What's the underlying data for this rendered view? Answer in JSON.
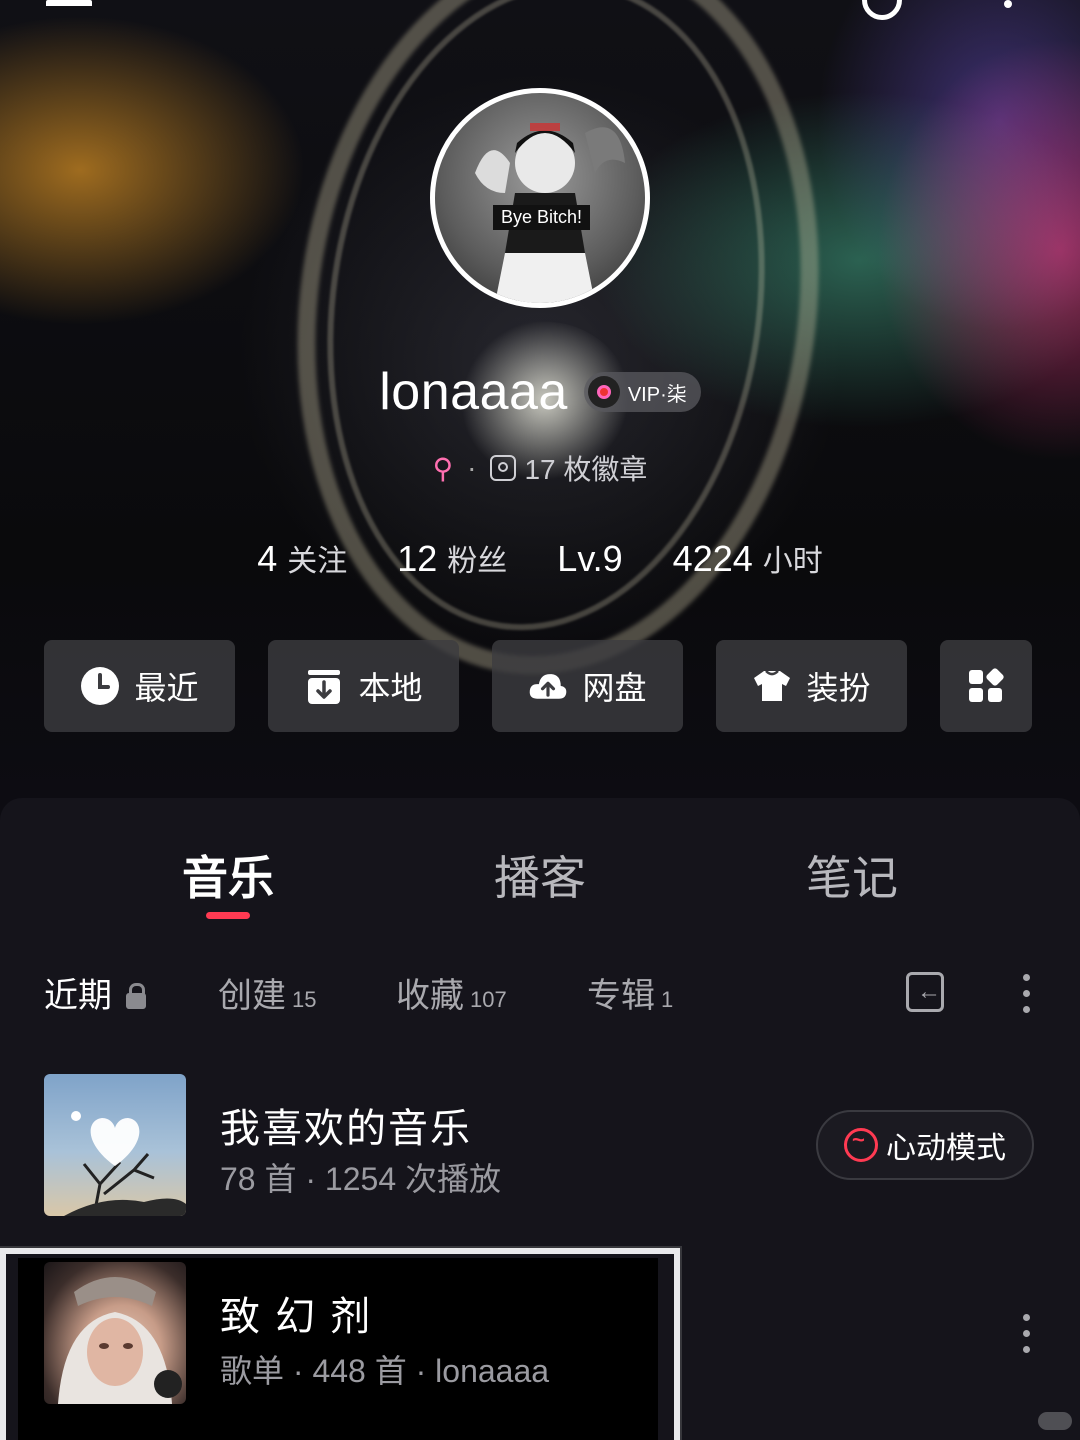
{
  "profile": {
    "avatar_caption": "Bye Bitch!",
    "username": "lonaaaa",
    "vip_label": "VIP·柒",
    "gender_symbol": "⚲",
    "separator": "·",
    "badges_text": "17 枚徽章"
  },
  "stats": [
    {
      "value": "4",
      "label": "关注"
    },
    {
      "value": "12",
      "label": "粉丝"
    },
    {
      "value": "Lv.9",
      "label": ""
    },
    {
      "value": "4224",
      "label": "小时"
    }
  ],
  "quick_actions": [
    {
      "label": "最近",
      "icon": "clock-icon"
    },
    {
      "label": "本地",
      "icon": "download-box-icon"
    },
    {
      "label": "网盘",
      "icon": "cloud-upload-icon"
    },
    {
      "label": "装扮",
      "icon": "tshirt-icon"
    },
    {
      "label": "",
      "icon": "apps-grid-icon"
    }
  ],
  "tabs": [
    "音乐",
    "播客",
    "笔记"
  ],
  "subtabs": [
    {
      "label": "近期",
      "count": ""
    },
    {
      "label": "创建",
      "count": "15"
    },
    {
      "label": "收藏",
      "count": "107"
    },
    {
      "label": "专辑",
      "count": "1"
    }
  ],
  "playlists": [
    {
      "title": "我喜欢的音乐",
      "meta": "78 首 · 1254 次播放",
      "action": "心动模式"
    },
    {
      "title": "致 幻 剂",
      "meta": "歌单 · 448 首 · lonaaaa"
    }
  ],
  "colors": {
    "accent": "#ff3a52",
    "background": "#15141b"
  }
}
